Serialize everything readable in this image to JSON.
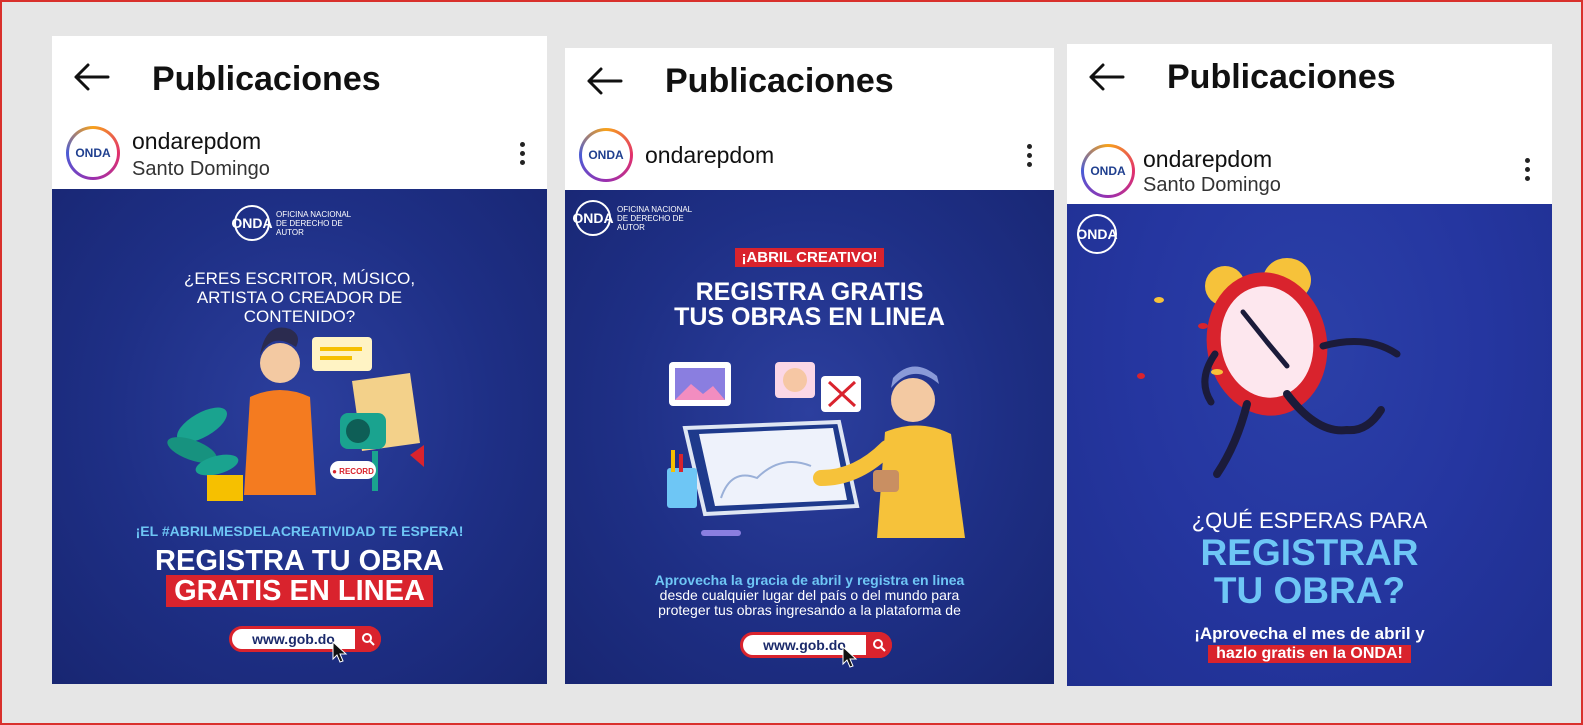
{
  "header_title": "Publicaciones",
  "cards": [
    {
      "username": "ondarepdom",
      "location": "Santo Domingo",
      "avatar_text": "ONDA",
      "logo_mark": "ONDA",
      "logo_sub": "Oficina Nacional de Derecho de Autor",
      "question": "¿ERES ESCRITOR, MÚSICO, ARTISTA O CREADOR DE CONTENIDO?",
      "record_label": "● RECORD",
      "hashtag": "¡EL #ABRILMESDELACREATIVIDAD TE ESPERA!",
      "headline_1": "REGISTRA TU OBRA",
      "headline_2": "GRATIS EN LINEA",
      "url": "www.gob.do"
    },
    {
      "username": "ondarepdom",
      "avatar_text": "ONDA",
      "logo_mark": "ONDA",
      "logo_sub": "Oficina Nacional de Derecho de Autor",
      "tag": "¡ABRIL CREATIVO!",
      "headline_1": "REGISTRA GRATIS",
      "headline_2": "TUS OBRAS EN LINEA",
      "body_1": "Aprovecha la gracia de abril y registra en linea",
      "body_2": "desde cualquier lugar del país o del mundo para",
      "body_3": "proteger tus obras ingresando a la plataforma de",
      "url": "www.gob.do"
    },
    {
      "username": "ondarepdom",
      "location": "Santo Domingo",
      "avatar_text": "ONDA",
      "logo_mark": "ONDA",
      "question": "¿QUÉ ESPERAS PARA",
      "headline_1": "REGISTRAR",
      "headline_2": "TU OBRA?",
      "body_1": "¡Aprovecha el mes de abril y",
      "body_2": "hazlo gratis en la ONDA!"
    }
  ],
  "colors": {
    "brand_blue": "#1e2f85",
    "accent_red": "#d9232d",
    "accent_light_blue": "#6ec6f5",
    "frame_border": "#d9302c"
  }
}
